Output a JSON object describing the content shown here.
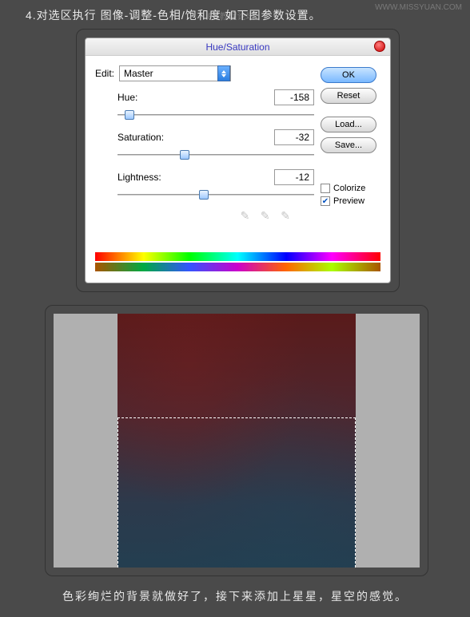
{
  "instruction": "4.对选区执行 图像-调整-色相/饱和度  如下图参数设置。",
  "watermark_center": "PS教程论坛",
  "watermark_right": "WWW.MISSYUAN.COM",
  "dialog": {
    "title": "Hue/Saturation",
    "edit_label": "Edit:",
    "edit_value": "Master",
    "hue": {
      "label": "Hue:",
      "value": "-158",
      "pos": 6
    },
    "saturation": {
      "label": "Saturation:",
      "value": "-32",
      "pos": 34
    },
    "lightness": {
      "label": "Lightness:",
      "value": "-12",
      "pos": 44
    },
    "buttons": {
      "ok": "OK",
      "reset": "Reset",
      "load": "Load...",
      "save": "Save..."
    },
    "colorize": {
      "label": "Colorize",
      "checked": false
    },
    "preview": {
      "label": "Preview",
      "checked": true
    }
  },
  "bottom_text": "色彩绚烂的背景就做好了，接下来添加上星星，星空的感觉。"
}
